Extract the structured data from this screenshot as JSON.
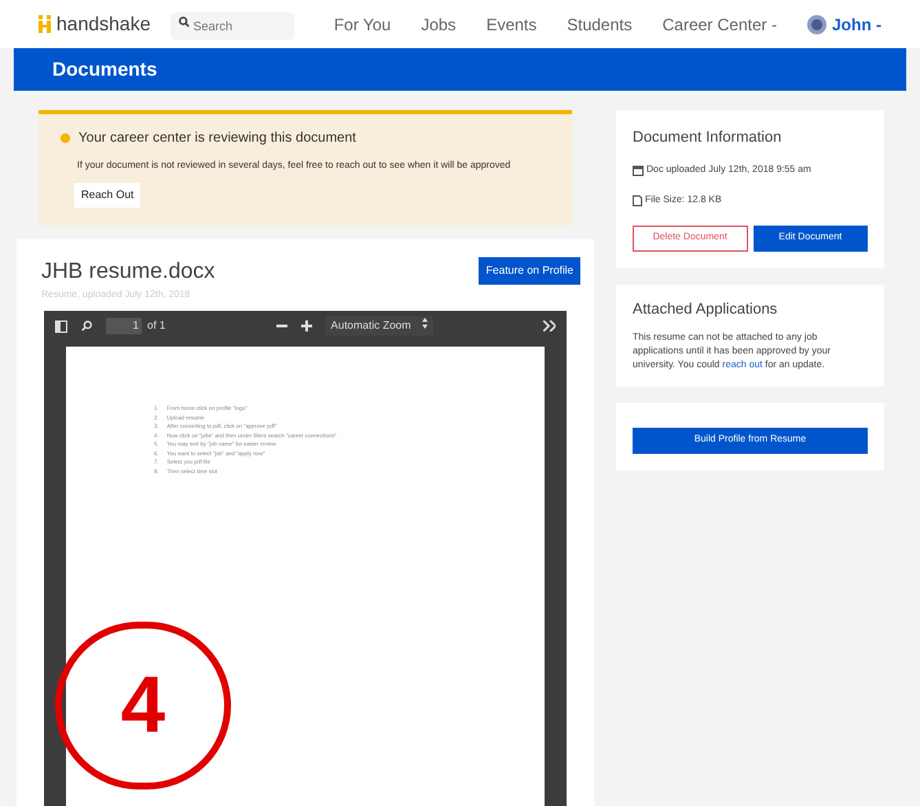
{
  "nav": {
    "brand": "handshake",
    "search": {
      "placeholder": "Search"
    },
    "links": [
      "For You",
      "Jobs",
      "Events",
      "Students",
      "Career Center -"
    ],
    "user": "John -"
  },
  "page_title": "Documents",
  "alert": {
    "title": "Your career center is reviewing this document",
    "message": "If your document is not reviewed in several days, feel free to reach out to see when it will be approved",
    "button": "Reach Out"
  },
  "document": {
    "name": "JHB resume.docx",
    "subtitle": "Resume, uploaded July 12th, 2018",
    "feature_button": "Feature on Profile",
    "viewer": {
      "page": "1",
      "page_count": "of 1",
      "zoom": "Automatic Zoom",
      "lines": [
        {
          "number": "1.",
          "text": "From home click on profile \"logo\""
        },
        {
          "number": "2.",
          "text": "Upload resume"
        },
        {
          "number": "3.",
          "text": "After converting to pdf, click on \"approve pdf\""
        },
        {
          "number": "4.",
          "text": "Now click on \"jobs\" and then under filters search \"career connections\""
        },
        {
          "number": "5.",
          "text": "You may sort by \"job name\" for easier review"
        },
        {
          "number": "6.",
          "text": "You want to select \"job\" and \"apply now\""
        },
        {
          "number": "7.",
          "text": "Select you pdf file"
        },
        {
          "number": "8.",
          "text": "Then select time slot"
        }
      ]
    }
  },
  "info": {
    "title": "Document Information",
    "uploaded": "Doc uploaded July 12th, 2018 9:55 am",
    "size": "File Size: 12.8 KB",
    "delete_button": "Delete Document",
    "edit_button": "Edit Document"
  },
  "attached": {
    "title": "Attached Applications",
    "text_before": "This resume can not be attached to any job applications until it has been approved by your university. You could",
    "link": "reach out",
    "text_after": "for an update."
  },
  "build_button": "Build Profile from Resume",
  "annotation": {
    "text": "4"
  }
}
